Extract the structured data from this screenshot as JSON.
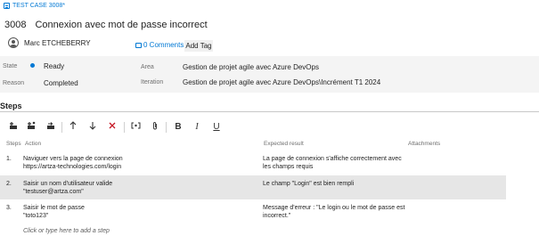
{
  "header": {
    "breadcrumb": "TEST CASE 3008*",
    "id": "3008",
    "title": "Connexion avec mot de passe incorrect",
    "user": "Marc ETCHEBERRY",
    "comments_label": "0 Comments",
    "add_tag_label": "Add Tag"
  },
  "fields": {
    "state_label": "State",
    "state_value": "Ready",
    "reason_label": "Reason",
    "reason_value": "Completed",
    "area_label": "Area",
    "area_value": "Gestion de projet agile avec Azure DevOps",
    "iteration_label": "Iteration",
    "iteration_value": "Gestion de projet agile avec Azure DevOps\\Incrément T1 2024",
    "state_color": "#0078d4"
  },
  "steps_section": {
    "title": "Steps",
    "toolbar": [
      "insert-step-icon",
      "insert-shared-steps-icon",
      "create-shared-steps-icon",
      "move-up-icon",
      "move-down-icon",
      "delete-icon",
      "insert-parameter-icon",
      "attachment-icon",
      "bold-icon",
      "italic-icon",
      "underline-icon"
    ],
    "toolbar_glyphs": {
      "bold": "B",
      "italic": "I",
      "underline": "U"
    },
    "columns": {
      "steps": "Steps",
      "action": "Action",
      "expected": "Expected result",
      "attachments": "Attachments"
    },
    "rows": [
      {
        "num": "1.",
        "action": "Naviguer vers la page de connexion\nhttps://artza-technologies.com/login",
        "expected": "La page de connexion s'affiche correctement avec\nles champs requis"
      },
      {
        "num": "2.",
        "action": "Saisir un nom d'utilisateur valide\n\"testuser@artza.com\"",
        "expected": "Le champ \"Login\" est bien rempli"
      },
      {
        "num": "3.",
        "action": "Saisir le mot de passe\n\"toto123\"",
        "expected": "Message d'erreur : \"Le login ou le mot de passe est\nincorrect.\""
      }
    ],
    "add_step_placeholder": "Click or type here to add a step"
  }
}
